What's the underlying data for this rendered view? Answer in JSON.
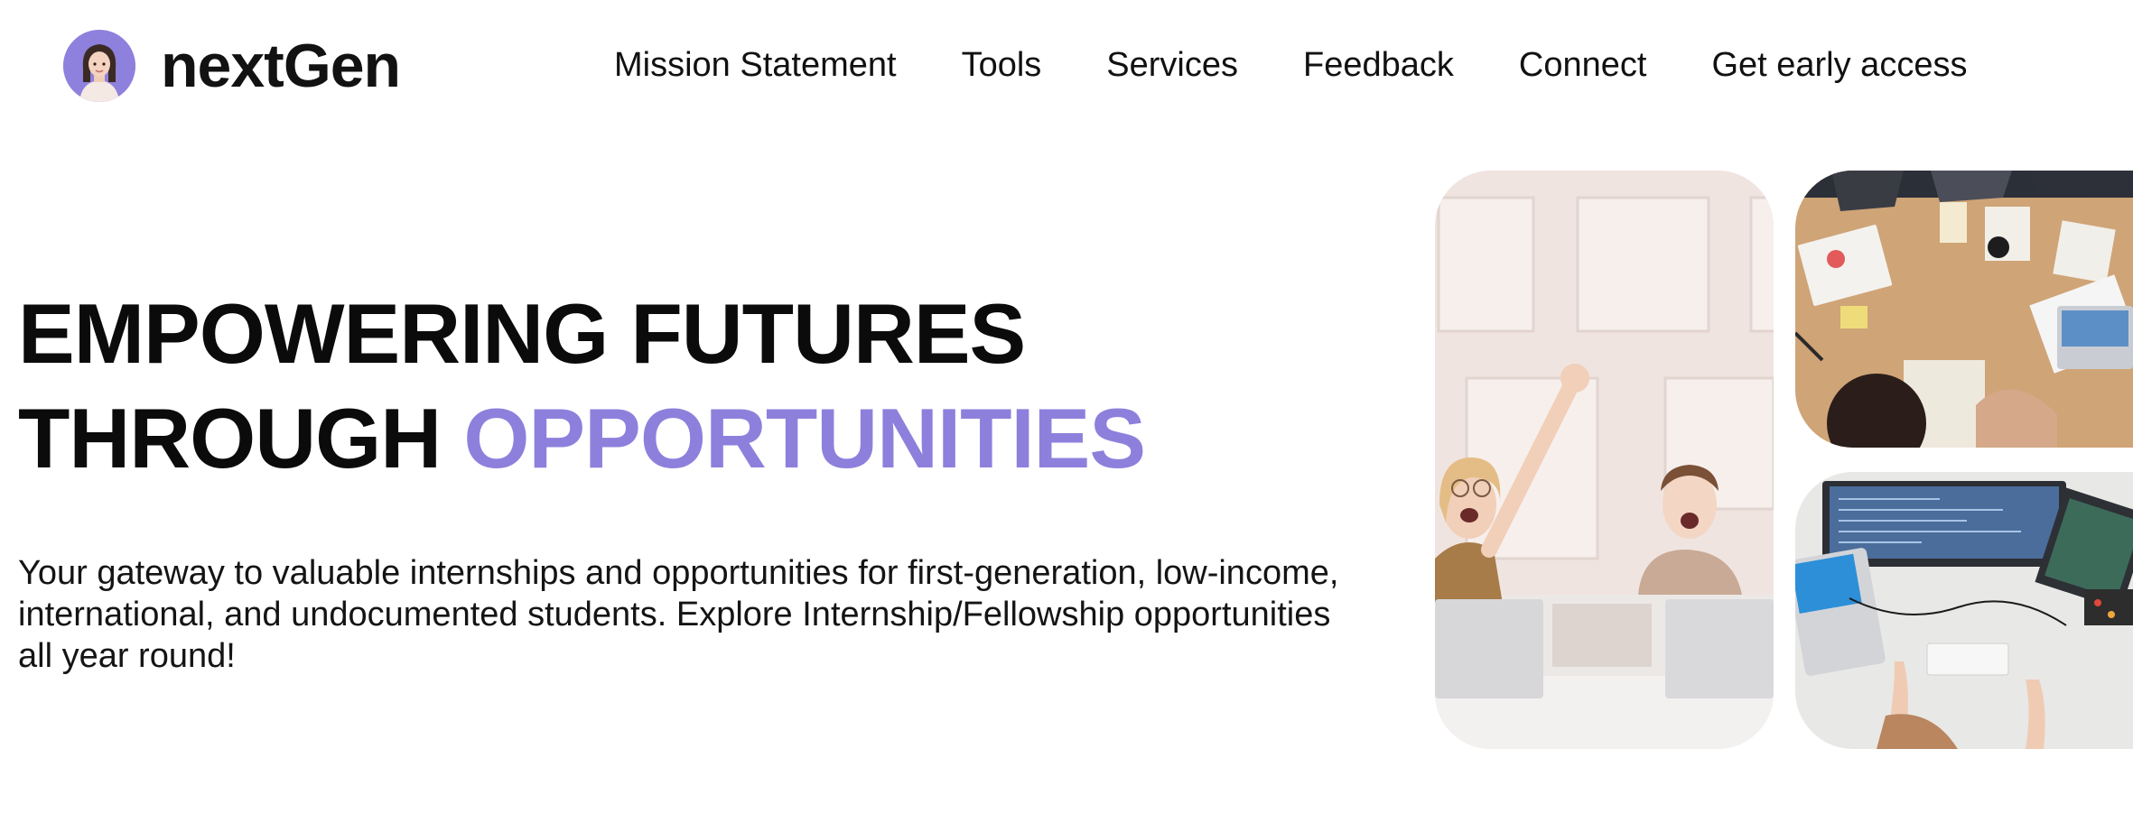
{
  "brand": {
    "name": "nextGen",
    "logo_icon": "woman-avatar-icon",
    "accent_color": "#8d80dc"
  },
  "nav": {
    "items": [
      {
        "label": "Mission Statement"
      },
      {
        "label": "Tools"
      },
      {
        "label": "Services"
      },
      {
        "label": "Feedback"
      },
      {
        "label": "Connect"
      },
      {
        "label": "Get early access"
      }
    ]
  },
  "hero": {
    "title_line1": "EMPOWERING FUTURES",
    "title_line2_prefix": "THROUGH ",
    "title_line2_accent": "OPPORTUNITIES",
    "description": "Your gateway to valuable internships and opportunities for first-generation, low-income, international, and undocumented students. Explore Internship/Fellowship opportunities all year round!"
  },
  "images": [
    {
      "name": "celebrating-women-photo"
    },
    {
      "name": "team-meeting-table-photo"
    },
    {
      "name": "developer-desk-photo"
    }
  ]
}
